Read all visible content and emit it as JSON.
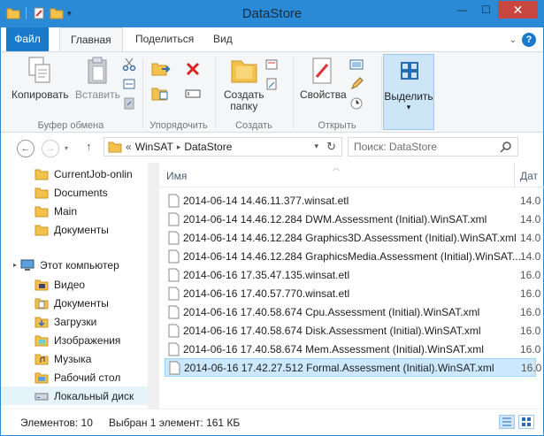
{
  "window": {
    "title": "DataStore"
  },
  "tabs": {
    "file": "Файл",
    "home": "Главная",
    "share": "Поделиться",
    "view": "Вид"
  },
  "ribbon": {
    "clipboard": {
      "copy": "Копировать",
      "paste": "Вставить",
      "group": "Буфер обмена"
    },
    "organize": {
      "group": "Упорядочить"
    },
    "create": {
      "new_folder": "Создать\nпапку",
      "group": "Создать"
    },
    "open": {
      "properties": "Свойства",
      "group": "Открыть"
    },
    "select": {
      "select": "Выделить"
    }
  },
  "address": {
    "prefix": "«",
    "crumbs": [
      "WinSAT",
      "DataStore"
    ]
  },
  "search": {
    "placeholder": "Поиск: DataStore"
  },
  "nav": {
    "items": [
      {
        "label": "CurrentJob-onlin",
        "icon": "folder-icon"
      },
      {
        "label": "Documents",
        "icon": "folder-icon"
      },
      {
        "label": "Main",
        "icon": "folder-icon"
      },
      {
        "label": "Документы",
        "icon": "folder-icon"
      },
      {
        "label": "Этот компьютер",
        "icon": "computer-icon"
      },
      {
        "label": "Видео",
        "icon": "video-folder-icon"
      },
      {
        "label": "Документы",
        "icon": "documents-folder-icon"
      },
      {
        "label": "Загрузки",
        "icon": "downloads-folder-icon"
      },
      {
        "label": "Изображения",
        "icon": "pictures-folder-icon"
      },
      {
        "label": "Музыка",
        "icon": "music-folder-icon"
      },
      {
        "label": "Рабочий стол",
        "icon": "desktop-folder-icon"
      },
      {
        "label": "Локальный диск",
        "icon": "drive-icon"
      }
    ]
  },
  "files": {
    "col_name": "Имя",
    "col_date": "Дат",
    "rows": [
      {
        "name": "2014-06-14 14.46.11.377.winsat.etl",
        "date": "14.0"
      },
      {
        "name": "2014-06-14 14.46.12.284 DWM.Assessment (Initial).WinSAT.xml",
        "date": "14.0"
      },
      {
        "name": "2014-06-14 14.46.12.284 Graphics3D.Assessment (Initial).WinSAT.xml",
        "date": "14.0"
      },
      {
        "name": "2014-06-14 14.46.12.284 GraphicsMedia.Assessment (Initial).WinSAT...",
        "date": "14.0"
      },
      {
        "name": "2014-06-16 17.35.47.135.winsat.etl",
        "date": "16.0"
      },
      {
        "name": "2014-06-16 17.40.57.770.winsat.etl",
        "date": "16.0"
      },
      {
        "name": "2014-06-16 17.40.58.674 Cpu.Assessment (Initial).WinSAT.xml",
        "date": "16.0"
      },
      {
        "name": "2014-06-16 17.40.58.674 Disk.Assessment (Initial).WinSAT.xml",
        "date": "16.0"
      },
      {
        "name": "2014-06-16 17.40.58.674 Mem.Assessment (Initial).WinSAT.xml",
        "date": "16.0"
      },
      {
        "name": "2014-06-16 17.42.27.512 Formal.Assessment (Initial).WinSAT.xml",
        "date": "16.0",
        "selected": true
      }
    ]
  },
  "status": {
    "count": "Элементов: 10",
    "selection": "Выбран 1 элемент: 161 КБ"
  },
  "colors": {
    "accent": "#2b8ad6",
    "file_tab": "#1979ca",
    "selection": "#cce8ff",
    "close": "#c7463f"
  }
}
